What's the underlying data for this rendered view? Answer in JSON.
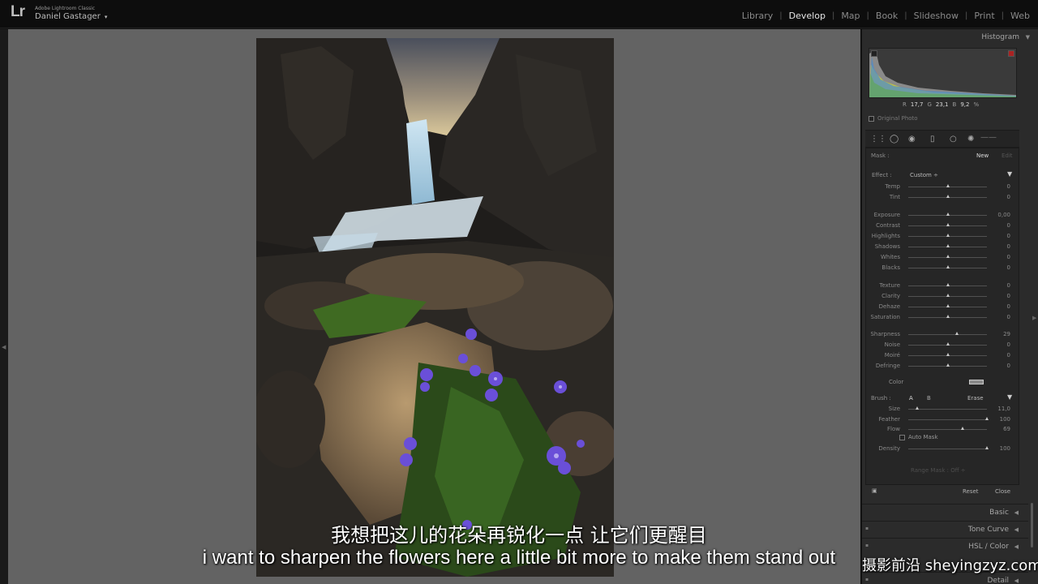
{
  "app": {
    "logo": "Lr",
    "product_name": "Adobe Lightroom Classic",
    "user_name": "Daniel Gastager",
    "user_caret": "▾"
  },
  "modules": [
    {
      "label": "Library",
      "active": false
    },
    {
      "label": "Develop",
      "active": true
    },
    {
      "label": "Map",
      "active": false
    },
    {
      "label": "Book",
      "active": false
    },
    {
      "label": "Slideshow",
      "active": false
    },
    {
      "label": "Print",
      "active": false
    },
    {
      "label": "Web",
      "active": false
    }
  ],
  "histogram": {
    "title": "Histogram",
    "collapse_icon": "triangle-down-icon",
    "r_label": "R",
    "r_value": "17,7",
    "g_label": "G",
    "g_value": "23,1",
    "b_label": "B",
    "b_value": "9,2",
    "unit": "%",
    "original_photo_label": "Original Photo"
  },
  "mask": {
    "label": "Mask :",
    "new_label": "New",
    "edit_label": "Edit"
  },
  "effect": {
    "label": "Effect :",
    "value": "Custom ÷",
    "collapse_icon": "triangle-down-icon"
  },
  "sliders": [
    {
      "label": "Temp",
      "value": "0",
      "position": 0.5
    },
    {
      "label": "Tint",
      "value": "0",
      "position": 0.5
    },
    {
      "label": "Exposure",
      "value": "0,00",
      "position": 0.5
    },
    {
      "label": "Contrast",
      "value": "0",
      "position": 0.5
    },
    {
      "label": "Highlights",
      "value": "0",
      "position": 0.5
    },
    {
      "label": "Shadows",
      "value": "0",
      "position": 0.5
    },
    {
      "label": "Whites",
      "value": "0",
      "position": 0.5
    },
    {
      "label": "Blacks",
      "value": "0",
      "position": 0.5
    },
    {
      "label": "Texture",
      "value": "0",
      "position": 0.5
    },
    {
      "label": "Clarity",
      "value": "0",
      "position": 0.5
    },
    {
      "label": "Dehaze",
      "value": "0",
      "position": 0.5
    },
    {
      "label": "Saturation",
      "value": "0",
      "position": 0.5
    },
    {
      "label": "Sharpness",
      "value": "29",
      "position": 0.62
    },
    {
      "label": "Noise",
      "value": "0",
      "position": 0.5
    },
    {
      "label": "Moiré",
      "value": "0",
      "position": 0.5
    },
    {
      "label": "Defringe",
      "value": "0",
      "position": 0.5
    }
  ],
  "color_label": "Color",
  "brush": {
    "label": "Brush :",
    "a_label": "A",
    "b_label": "B",
    "erase_label": "Erase",
    "collapse_icon": "triangle-down-icon",
    "sliders": [
      {
        "label": "Size",
        "value": "11,0",
        "position": 0.11
      },
      {
        "label": "Feather",
        "value": "100",
        "position": 1.0
      },
      {
        "label": "Flow",
        "value": "69",
        "position": 0.69
      }
    ],
    "auto_mask_label": "Auto Mask",
    "density": {
      "label": "Density",
      "value": "100",
      "position": 1.0
    }
  },
  "range_mask": "Range Mask : Off ÷",
  "actions": {
    "reset_label": "Reset",
    "close_label": "Close"
  },
  "sections": [
    {
      "label": "Basic"
    },
    {
      "label": "Tone Curve"
    },
    {
      "label": "HSL / Color"
    },
    {
      "label": "Detail"
    }
  ],
  "subtitles": {
    "chinese": "我想把这儿的花朵再锐化一点 让它们更醒目",
    "english": "i want to sharpen the flowers here a little bit more to make them stand out"
  },
  "watermark": "摄影前沿 sheyingzyz.com",
  "colors": {
    "accent_active": "#e6e6e6",
    "canvas_gray": "#636363",
    "panel_bg": "#2b2b2b",
    "flower_purple": "#6a4fd8"
  }
}
